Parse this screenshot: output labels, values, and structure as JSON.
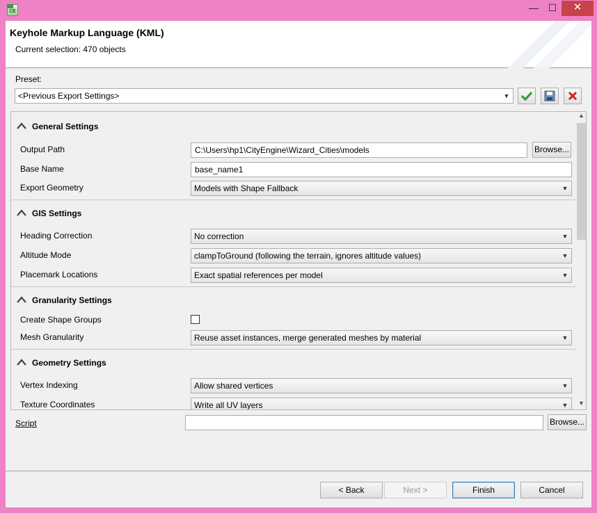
{
  "window": {
    "app_icon_text": "CE",
    "minimize_glyph": "—",
    "maximize_glyph": "☐",
    "close_glyph": "✕"
  },
  "header": {
    "title": "Keyhole Markup Language (KML)",
    "subtitle": "Current selection: 470 objects"
  },
  "preset": {
    "label": "Preset:",
    "value": "<Previous Export Settings>",
    "icons": [
      "checkmark-icon",
      "save-disk-icon",
      "delete-x-icon"
    ]
  },
  "sections": {
    "general": {
      "title": "General Settings",
      "output_path_label": "Output Path",
      "output_path_value": "C:\\Users\\hp1\\CityEngine\\Wizard_Cities\\models",
      "browse_label": "Browse...",
      "base_name_label": "Base Name",
      "base_name_value": "base_name1",
      "export_geometry_label": "Export Geometry",
      "export_geometry_value": "Models with Shape Fallback"
    },
    "gis": {
      "title": "GIS Settings",
      "heading_label": "Heading Correction",
      "heading_value": "No correction",
      "altitude_label": "Altitude Mode",
      "altitude_value": "clampToGround (following the terrain, ignores altitude values)",
      "placemark_label": "Placemark Locations",
      "placemark_value": "Exact spatial references per model"
    },
    "granularity": {
      "title": "Granularity Settings",
      "shape_groups_label": "Create Shape Groups",
      "shape_groups_checked": false,
      "mesh_label": "Mesh Granularity",
      "mesh_value": "Reuse asset instances, merge generated meshes by material"
    },
    "geometry": {
      "title": "Geometry Settings",
      "vertex_label": "Vertex Indexing",
      "vertex_value": "Allow shared vertices",
      "texcoord_label": "Texture Coordinates",
      "texcoord_value": "Write all UV layers"
    }
  },
  "script": {
    "label": "Script",
    "value": "",
    "browse_label": "Browse..."
  },
  "footer": {
    "back_label": "< Back",
    "next_label": "Next >",
    "finish_label": "Finish",
    "cancel_label": "Cancel"
  }
}
